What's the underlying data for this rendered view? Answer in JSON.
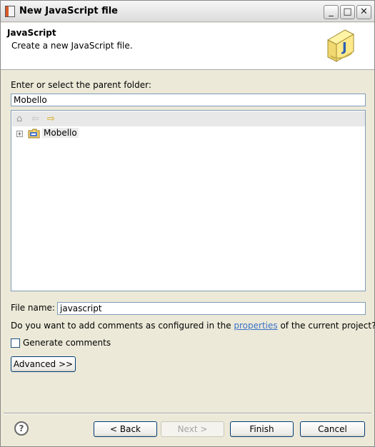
{
  "window": {
    "title": "New JavaScript file",
    "minimize_glyph": "_",
    "maximize_glyph": "□",
    "close_glyph": "✕"
  },
  "header": {
    "title": "JavaScript",
    "description": "Create a new JavaScript file."
  },
  "parent_folder": {
    "label": "Enter or select the parent folder:",
    "value": "Mobello"
  },
  "tree": {
    "toolbar": [
      "home-icon",
      "back-arrow-icon",
      "forward-arrow-icon"
    ],
    "items": [
      {
        "label": "Mobello",
        "expanded": false
      }
    ]
  },
  "file_name": {
    "label": "File name:",
    "value": "javascript"
  },
  "comments": {
    "question_before": "Do you want to add comments as configured in the ",
    "question_link": "properties",
    "question_after": " of the current project?",
    "checkbox_label": "Generate comments",
    "checked": false
  },
  "buttons": {
    "advanced": "Advanced >>",
    "back": "< Back",
    "next": "Next >",
    "finish": "Finish",
    "cancel": "Cancel",
    "help": "?"
  }
}
